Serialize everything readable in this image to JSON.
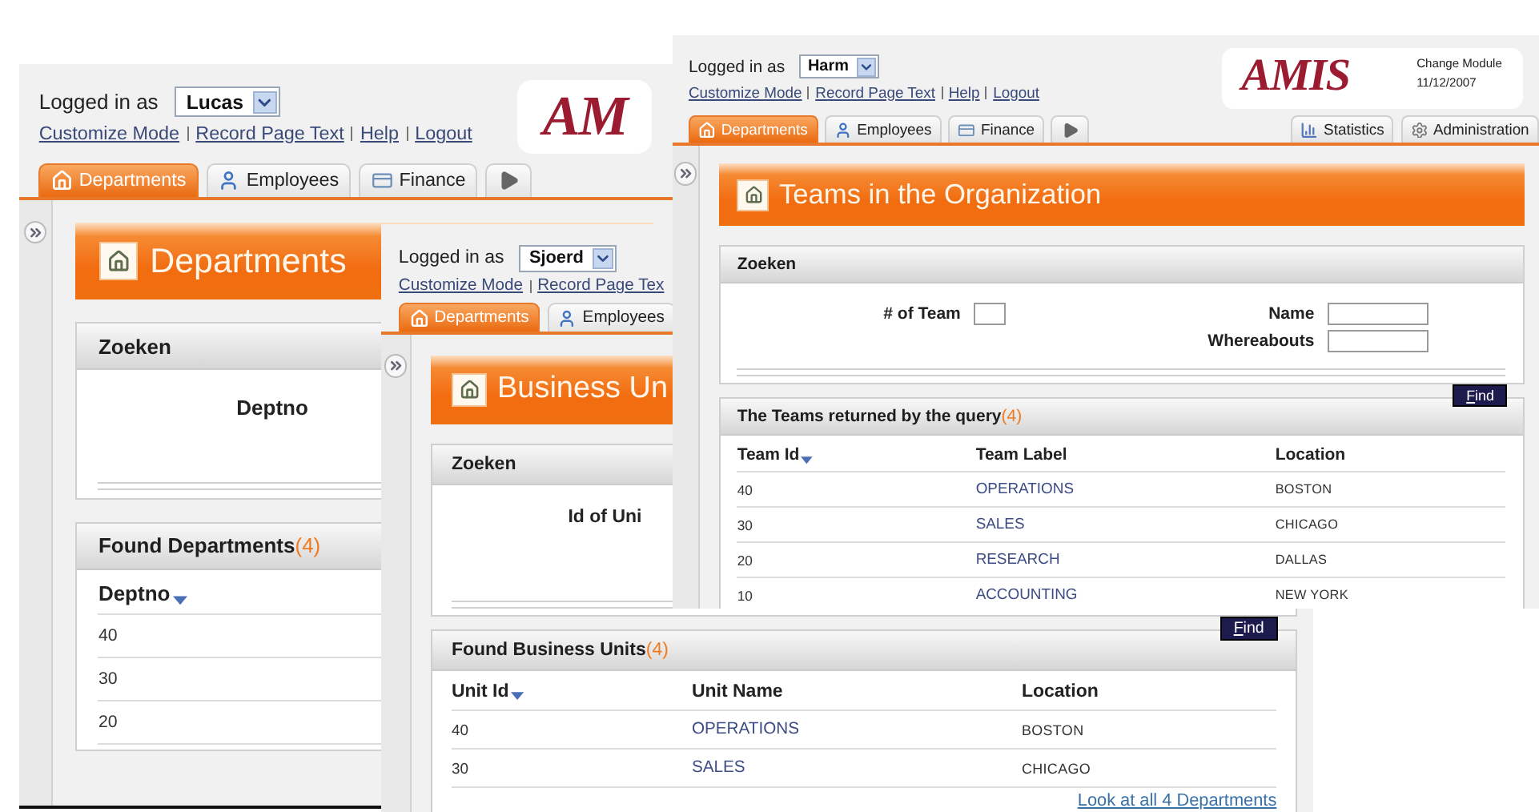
{
  "windows": [
    {
      "login_label": "Logged in as",
      "user": "Lucas",
      "logo": "AM",
      "links": [
        "Customize Mode",
        "Record Page Text",
        "Help",
        "Logout"
      ],
      "tabs": [
        {
          "kind": "home",
          "label": "Departments",
          "selected": true
        },
        {
          "kind": "person",
          "label": "Employees",
          "selected": false
        },
        {
          "kind": "card",
          "label": "Finance",
          "selected": false
        },
        {
          "kind": "more",
          "selected": false
        }
      ],
      "title": "Departments",
      "search": {
        "title": "Zoeken",
        "columns": [
          [
            {
              "label": "Deptno",
              "input": false
            }
          ]
        ]
      },
      "results": {
        "title": "Found Departments",
        "count": "(4)",
        "columns": [
          {
            "label": "Deptno",
            "kind": "number",
            "sorted": true
          }
        ],
        "rows": [
          [
            "40"
          ],
          [
            "30"
          ],
          [
            "20"
          ]
        ]
      }
    },
    {
      "login_label": "Logged in as",
      "user": "Sjoerd",
      "links": [
        "Customize Mode",
        "Record Page Tex"
      ],
      "tabs": [
        {
          "kind": "home",
          "label": "Departments",
          "selected": true
        },
        {
          "kind": "person",
          "label": "Employees",
          "selected": false
        }
      ],
      "title": "Business Un",
      "search": {
        "title": "Zoeken",
        "columns": [
          [
            {
              "label": "Id of Uni",
              "input": false
            }
          ]
        ],
        "button": "Find"
      },
      "results": {
        "title": "Found Business Units",
        "count": "(4)",
        "columns": [
          {
            "label": "Unit Id",
            "kind": "number",
            "sorted": true
          },
          {
            "label": "Unit Name",
            "kind": "link",
            "sorted": false
          },
          {
            "label": "Location",
            "kind": "place",
            "sorted": false
          }
        ],
        "rows": [
          [
            "40",
            "OPERATIONS",
            "BOSTON"
          ],
          [
            "30",
            "SALES",
            "CHICAGO"
          ]
        ],
        "footer_link": "Look at all 4 Departments"
      }
    },
    {
      "login_label": "Logged in as",
      "user": "Harm",
      "logo": "AMIS",
      "module": {
        "label": "Change Module",
        "date": "11/12/2007"
      },
      "links": [
        "Customize Mode",
        "Record Page Text",
        "Help",
        "Logout"
      ],
      "tabs": [
        {
          "kind": "home",
          "label": "Departments",
          "selected": true
        },
        {
          "kind": "person",
          "label": "Employees",
          "selected": false
        },
        {
          "kind": "card",
          "label": "Finance",
          "selected": false
        },
        {
          "kind": "more",
          "selected": false
        }
      ],
      "right_tabs": [
        {
          "kind": "chart",
          "label": "Statistics",
          "selected": false
        },
        {
          "kind": "gear",
          "label": "Administration",
          "selected": false
        }
      ],
      "title": "Teams in the Organization",
      "search": {
        "title": "Zoeken",
        "columns": [
          [
            {
              "label": "# of Team",
              "input": true
            }
          ],
          [
            {
              "label": "Name",
              "input": true
            },
            {
              "label": "Whereabouts",
              "input": true
            }
          ]
        ],
        "button": "Find"
      },
      "results": {
        "title": "The Teams returned by the query",
        "count": "(4)",
        "columns": [
          {
            "label": "Team Id",
            "kind": "number",
            "sorted": true
          },
          {
            "label": "Team Label",
            "kind": "link",
            "sorted": false
          },
          {
            "label": "Location",
            "kind": "place",
            "sorted": false
          }
        ],
        "rows": [
          [
            "40",
            "OPERATIONS",
            "BOSTON"
          ],
          [
            "30",
            "SALES",
            "CHICAGO"
          ],
          [
            "20",
            "RESEARCH",
            "DALLAS"
          ],
          [
            "10",
            "ACCOUNTING",
            "NEW YORK"
          ]
        ]
      }
    }
  ]
}
